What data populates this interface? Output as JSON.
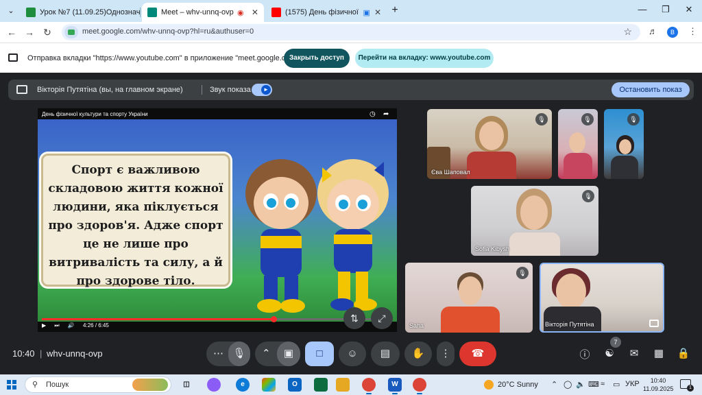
{
  "browser": {
    "tabs": [
      {
        "title": "Урок №7 (11.09.25)Однозначн…",
        "favicon_color": "#1e8e3e"
      },
      {
        "title": "Meet – whv-unnq-ovp",
        "favicon_color": "#00897b"
      },
      {
        "title": "(1575) День фізичної культ…",
        "favicon_color": "#ff0000"
      }
    ],
    "url": "meet.google.com/whv-unnq-ovp?hl=ru&authuser=0",
    "profile_initial": "В"
  },
  "infobar": {
    "message": "Отправка вкладки \"https://www.youtube.com\" в приложение \"meet.google.com\"…",
    "stop_access": "Закрыть доступ",
    "goto_tab": "Перейти на вкладку: www.youtube.com"
  },
  "presenting": {
    "presenter": "Вікторія Путятіна (вы, на главном экране)",
    "sound_label": "Звук показа",
    "stop_button": "Остановить показ"
  },
  "video": {
    "title": "День фізичної культури та спорту України",
    "slide_text": "Спорт є важливою складовою життя кожної людини, яка піклується про здоров'я. Адже спорт це не лише про витривалість та силу, а й про здорове тіло.",
    "time": "4:26 / 6:45",
    "progress": 0.66
  },
  "participants": [
    {
      "name": "Єва Шаповал",
      "muted": true
    },
    {
      "name": "",
      "muted": true
    },
    {
      "name": "",
      "muted": true
    },
    {
      "name": "Sofia Kibysh",
      "muted": true
    },
    {
      "name": "Saha",
      "muted": true
    },
    {
      "name": "Вікторія Путятіна",
      "muted": false
    }
  ],
  "meeting": {
    "time": "10:40",
    "code": "whv-unnq-ovp",
    "participant_count": "7"
  },
  "taskbar": {
    "search_placeholder": "Пошук",
    "weather": "20°C  Sunny",
    "language": "УКР",
    "time": "10:40",
    "date": "11.09.2025",
    "notifications": "1"
  },
  "colors": {
    "meet_bg": "#202124",
    "accent": "#a8c7fa",
    "end_call": "#dc362e",
    "infobar_dark": "#11555f"
  }
}
